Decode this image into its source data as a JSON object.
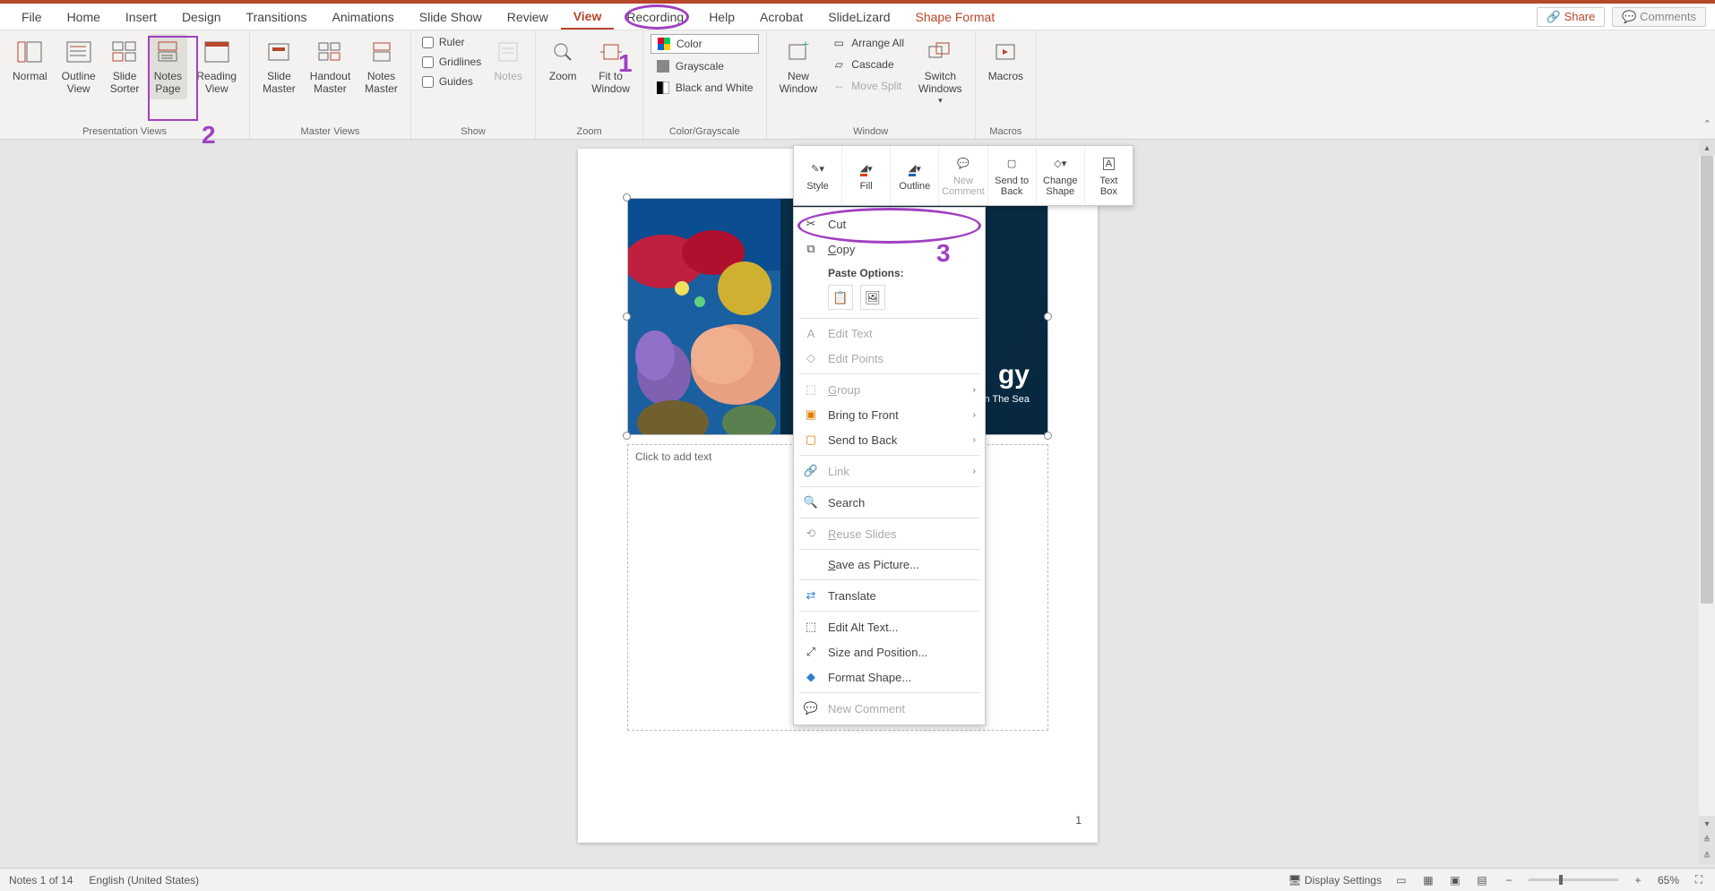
{
  "menubar": {
    "tabs": [
      "File",
      "Home",
      "Insert",
      "Design",
      "Transitions",
      "Animations",
      "Slide Show",
      "Review",
      "View",
      "Recording",
      "Help",
      "Acrobat",
      "SlideLizard",
      "Shape Format"
    ],
    "active": "View",
    "share": "Share",
    "comments": "Comments"
  },
  "ribbon": {
    "presentation_views": {
      "label": "Presentation Views",
      "normal": "Normal",
      "outline": "Outline\nView",
      "sorter": "Slide\nSorter",
      "notes_page": "Notes\nPage",
      "reading": "Reading\nView"
    },
    "master_views": {
      "label": "Master Views",
      "slide": "Slide\nMaster",
      "handout": "Handout\nMaster",
      "notes": "Notes\nMaster"
    },
    "show": {
      "label": "Show",
      "ruler": "Ruler",
      "gridlines": "Gridlines",
      "guides": "Guides",
      "notes": "Notes"
    },
    "zoom": {
      "label": "Zoom",
      "zoom": "Zoom",
      "fit": "Fit to\nWindow"
    },
    "color": {
      "label": "Color/Grayscale",
      "color": "Color",
      "grayscale": "Grayscale",
      "bw": "Black and White"
    },
    "window": {
      "label": "Window",
      "new": "New\nWindow",
      "arrange": "Arrange All",
      "cascade": "Cascade",
      "move_split": "Move Split",
      "switch": "Switch\nWindows"
    },
    "macros": {
      "label": "Macros",
      "macros": "Macros"
    }
  },
  "slide": {
    "title": "gy",
    "subtitle": "n The Sea",
    "notes_placeholder": "Click to add text",
    "page_number": "1"
  },
  "mini_toolbar": {
    "style": "Style",
    "fill": "Fill",
    "outline": "Outline",
    "new_comment": "New\nComment",
    "send_back": "Send to\nBack",
    "change_shape": "Change\nShape",
    "text_box": "Text\nBox"
  },
  "context_menu": {
    "cut": "Cut",
    "copy": "Copy",
    "paste_options": "Paste Options:",
    "edit_text": "Edit Text",
    "edit_points": "Edit Points",
    "group": "Group",
    "bring_front": "Bring to Front",
    "send_back": "Send to Back",
    "link": "Link",
    "search": "Search",
    "reuse": "Reuse Slides",
    "save_picture": "Save as Picture...",
    "translate": "Translate",
    "alt_text": "Edit Alt Text...",
    "size_pos": "Size and Position...",
    "format_shape": "Format Shape...",
    "new_comment": "New Comment"
  },
  "annotations": {
    "num1": "1",
    "num2": "2",
    "num3": "3"
  },
  "statusbar": {
    "notes": "Notes 1 of 14",
    "lang": "English (United States)",
    "display_settings": "Display Settings",
    "zoom": "65%"
  }
}
